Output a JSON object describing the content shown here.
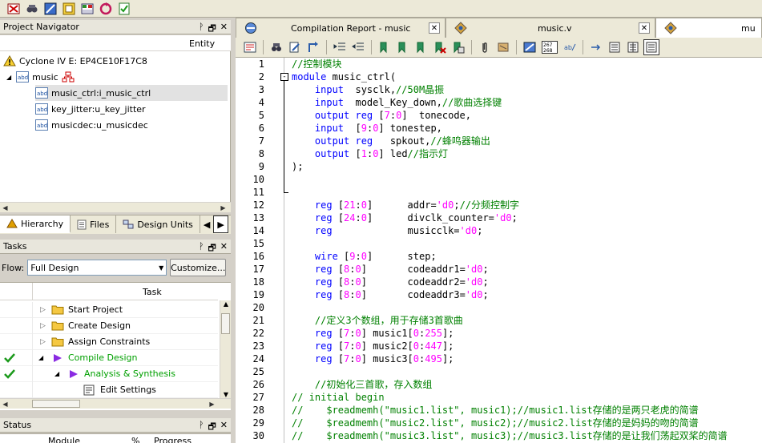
{
  "navigator": {
    "title": "Project Navigator",
    "entity_header": "Entity",
    "device": "Cyclone IV E: EP4CE10F17C8",
    "top_module": "music",
    "instances": [
      "music_ctrl:i_music_ctrl",
      "key_jitter:u_key_jitter",
      "musicdec:u_musicdec"
    ],
    "tabs": [
      "Hierarchy",
      "Files",
      "Design Units"
    ]
  },
  "tasks": {
    "title": "Tasks",
    "flow_label": "Flow:",
    "flow_value": "Full Design",
    "customize_label": "Customize...",
    "task_header": "Task",
    "rows": [
      {
        "label": "Start Project",
        "status": ""
      },
      {
        "label": "Create Design",
        "status": ""
      },
      {
        "label": "Assign Constraints",
        "status": ""
      },
      {
        "label": "Compile Design",
        "status": "done"
      },
      {
        "label": "Analysis & Synthesis",
        "status": "done"
      },
      {
        "label": "Edit Settings",
        "status": ""
      }
    ]
  },
  "status_panel": {
    "title": "Status",
    "cols": [
      "Module",
      "%",
      "Progress"
    ]
  },
  "panel_ctrls": {
    "pin": "ᚹ",
    "restore": "🗗",
    "close": "✕"
  },
  "editor": {
    "tabs": [
      {
        "label": "Compilation Report - music",
        "active": false
      },
      {
        "label": "music.v",
        "active": false
      },
      {
        "label": "mu",
        "active": true
      }
    ],
    "lines": [
      {
        "n": "1",
        "html": "<span class='cm'>//控制模块</span>"
      },
      {
        "n": "2",
        "html": "<span class='kw'>module</span> music_ctrl(",
        "fold": "-"
      },
      {
        "n": "3",
        "html": "    <span class='kw'>input</span>  sysclk,<span class='cm'>//50M晶振</span>"
      },
      {
        "n": "4",
        "html": "    <span class='kw'>input</span>  model_Key_down,<span class='cm'>//歌曲选择键</span>"
      },
      {
        "n": "5",
        "html": "    <span class='kw'>output reg</span> [<span class='nm'>7</span>:<span class='nm'>0</span>]  tonecode,"
      },
      {
        "n": "6",
        "html": "    <span class='kw'>input</span>  [<span class='nm'>9</span>:<span class='nm'>0</span>] tonestep,"
      },
      {
        "n": "7",
        "html": "    <span class='kw'>output reg</span>   spkout,<span class='cm'>//蜂鸣器输出</span>"
      },
      {
        "n": "8",
        "html": "    <span class='kw'>output</span> [<span class='nm'>1</span>:<span class='nm'>0</span>] led<span class='cm'>//指示灯</span>"
      },
      {
        "n": "9",
        "html": ");"
      },
      {
        "n": "10",
        "html": ""
      },
      {
        "n": "11",
        "html": ""
      },
      {
        "n": "12",
        "html": "    <span class='kw'>reg</span> [<span class='nm'>21</span>:<span class='nm'>0</span>]      addr=<span class='nm'>'d0</span>;<span class='cm'>//分频控制字</span>"
      },
      {
        "n": "13",
        "html": "    <span class='kw'>reg</span> [<span class='nm'>24</span>:<span class='nm'>0</span>]      divclk_counter=<span class='nm'>'d0</span>;"
      },
      {
        "n": "14",
        "html": "    <span class='kw'>reg</span>             musicclk=<span class='nm'>'d0</span>;"
      },
      {
        "n": "15",
        "html": ""
      },
      {
        "n": "16",
        "html": "    <span class='kw'>wire</span> [<span class='nm'>9</span>:<span class='nm'>0</span>]      step;"
      },
      {
        "n": "17",
        "html": "    <span class='kw'>reg</span> [<span class='nm'>8</span>:<span class='nm'>0</span>]       codeaddr1=<span class='nm'>'d0</span>;"
      },
      {
        "n": "18",
        "html": "    <span class='kw'>reg</span> [<span class='nm'>8</span>:<span class='nm'>0</span>]       codeaddr2=<span class='nm'>'d0</span>;"
      },
      {
        "n": "19",
        "html": "    <span class='kw'>reg</span> [<span class='nm'>8</span>:<span class='nm'>0</span>]       codeaddr3=<span class='nm'>'d0</span>;"
      },
      {
        "n": "20",
        "html": ""
      },
      {
        "n": "21",
        "html": "    <span class='cm'>//定义3个数组，用于存储3首歌曲</span>"
      },
      {
        "n": "22",
        "html": "    <span class='kw'>reg</span> [<span class='nm'>7</span>:<span class='nm'>0</span>] music1[<span class='nm'>0</span>:<span class='nm'>255</span>];"
      },
      {
        "n": "23",
        "html": "    <span class='kw'>reg</span> [<span class='nm'>7</span>:<span class='nm'>0</span>] music2[<span class='nm'>0</span>:<span class='nm'>447</span>];"
      },
      {
        "n": "24",
        "html": "    <span class='kw'>reg</span> [<span class='nm'>7</span>:<span class='nm'>0</span>] music3[<span class='nm'>0</span>:<span class='nm'>495</span>];"
      },
      {
        "n": "25",
        "html": ""
      },
      {
        "n": "26",
        "html": "    <span class='cm'>//初始化三首歌，存入数组</span>"
      },
      {
        "n": "27",
        "html": "<span class='cm'>// initial begin</span>"
      },
      {
        "n": "28",
        "html": "<span class='cm'>//    $readmemh(\"music1.list\", music1);//music1.list存储的是两只老虎的简谱</span>"
      },
      {
        "n": "29",
        "html": "<span class='cm'>//    $readmemh(\"music2.list\", music2);//music2.list存储的是妈妈的吻的简谱</span>"
      },
      {
        "n": "30",
        "html": "<span class='cm'>//    $readmemh(\"music3.list\", music3);//music3.list存储的是让我们荡起双桨的简谱</span>"
      }
    ]
  }
}
